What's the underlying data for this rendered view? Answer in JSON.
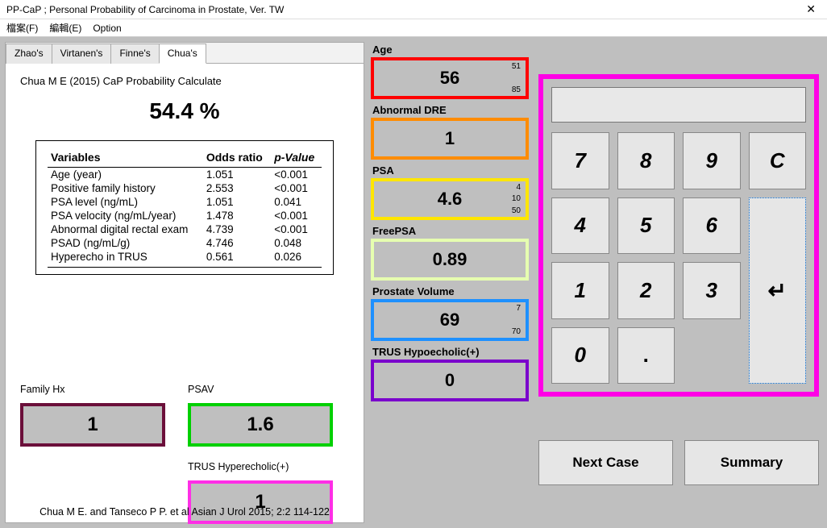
{
  "window": {
    "title": "PP-CaP ; Personal Probability of Carcinoma in Prostate, Ver. TW"
  },
  "menu": {
    "file": "檔案(F)",
    "edit": "編輯(E)",
    "option": "Option"
  },
  "tabs": [
    "Zhao's",
    "Virtanen's",
    "Finne's",
    "Chua's"
  ],
  "active_tab": "Chua's",
  "model": {
    "heading": "Chua M E (2015) CaP Probability Calculate",
    "probability": "54.4 %",
    "table_headers": {
      "var": "Variables",
      "or": "Odds ratio",
      "p": "p-Value"
    },
    "rows": [
      {
        "var": "Age (year)",
        "or": "1.051",
        "p": "<0.001"
      },
      {
        "var": "Positive family history",
        "or": "2.553",
        "p": "<0.001"
      },
      {
        "var": "PSA level (ng/mL)",
        "or": "1.051",
        "p": "0.041"
      },
      {
        "var": "PSA velocity (ng/mL/year)",
        "or": "1.478",
        "p": "<0.001"
      },
      {
        "var": "Abnormal digital rectal exam",
        "or": "4.739",
        "p": "<0.001"
      },
      {
        "var": "PSAD (ng/mL/g)",
        "or": "4.746",
        "p": "0.048"
      },
      {
        "var": "Hyperecho in TRUS",
        "or": "0.561",
        "p": "0.026"
      }
    ],
    "citation": "Chua M E. and Tanseco P P. et al   Asian J Urol  2015; 2:2 114-122"
  },
  "left_inputs": {
    "familyhx": {
      "label": "Family Hx",
      "value": "1",
      "color": "#6b0f3a"
    },
    "psav": {
      "label": "PSAV",
      "value": "1.6",
      "color": "#00d000"
    },
    "trus_hyper": {
      "label": "TRUS Hyperecholic(+)",
      "value": "1",
      "color": "#ff2ee6"
    }
  },
  "params": {
    "age": {
      "label": "Age",
      "value": "56",
      "min": "51",
      "max": "85",
      "color": "#ff0000"
    },
    "dre": {
      "label": "Abnormal DRE",
      "value": "1",
      "color": "#ff8c00"
    },
    "psa": {
      "label": "PSA",
      "value": "4.6",
      "min": "4",
      "mid": "10",
      "max": "50",
      "color": "#ffe600"
    },
    "freepsa": {
      "label": "FreePSA",
      "value": "0.89",
      "color": "#e6ffb0"
    },
    "pvol": {
      "label": "Prostate Volume",
      "value": "69",
      "min": "7",
      "max": "70",
      "color": "#1e90ff"
    },
    "trus_hypo": {
      "label": "TRUS Hypoecholic(+)",
      "value": "0",
      "color": "#7a00cc"
    }
  },
  "keypad": {
    "display": "",
    "keys": [
      "7",
      "8",
      "9",
      "C",
      "4",
      "5",
      "6",
      "1",
      "2",
      "3",
      "0",
      "."
    ],
    "enter": "↵"
  },
  "buttons": {
    "next": "Next Case",
    "summary": "Summary"
  }
}
